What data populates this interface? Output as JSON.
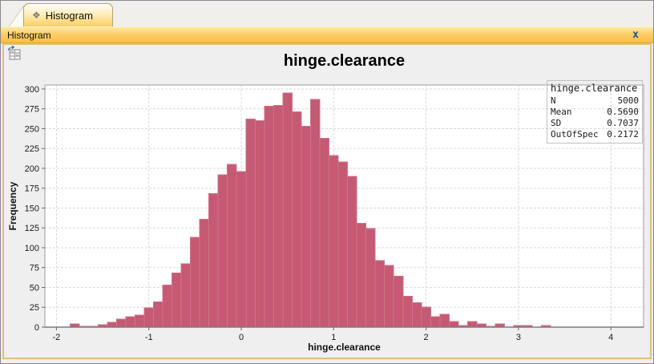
{
  "window": {
    "tab": {
      "label": "Histogram",
      "icon_glyph": "❖"
    },
    "titlebar": {
      "title": "Histogram",
      "close": "x"
    }
  },
  "chart_data": {
    "type": "bar",
    "subtype": "histogram",
    "title": "hinge.clearance",
    "xlabel": "hinge.clearance",
    "ylabel": "Frequency",
    "bin_start": -1.85,
    "bin_width": 0.1,
    "counts": [
      4,
      1,
      1,
      3,
      6,
      10,
      13,
      15,
      24,
      32,
      53,
      68,
      80,
      113,
      136,
      168,
      192,
      205,
      196,
      262,
      260,
      278,
      279,
      295,
      271,
      253,
      287,
      238,
      216,
      208,
      190,
      131,
      124,
      84,
      78,
      64,
      39,
      31,
      25,
      13,
      16,
      7,
      2,
      7,
      4,
      1,
      4,
      0,
      2,
      2,
      0,
      2
    ],
    "x_ticks": [
      -2,
      -1,
      0,
      1,
      2,
      3,
      4
    ],
    "y_ticks": [
      0,
      25,
      50,
      75,
      100,
      125,
      150,
      175,
      200,
      225,
      250,
      275,
      300
    ],
    "xlim": [
      -2.125,
      4.354
    ],
    "ylim": [
      0,
      305
    ],
    "grid": "dashed-both",
    "legend_position": "top-right",
    "bar_color": "#c65973",
    "bar_border_color": "#cf7289",
    "grid_color": "#d8d8d8",
    "plot_border_color": "#9c9c9c",
    "legend": {
      "title": "hinge.clearance",
      "rows": [
        {
          "label": "N",
          "value": "5000"
        },
        {
          "label": "Mean",
          "value": "0.5690"
        },
        {
          "label": "SD",
          "value": "0.7037"
        },
        {
          "label": "OutOfSpec",
          "value": "0.2172"
        }
      ]
    }
  }
}
